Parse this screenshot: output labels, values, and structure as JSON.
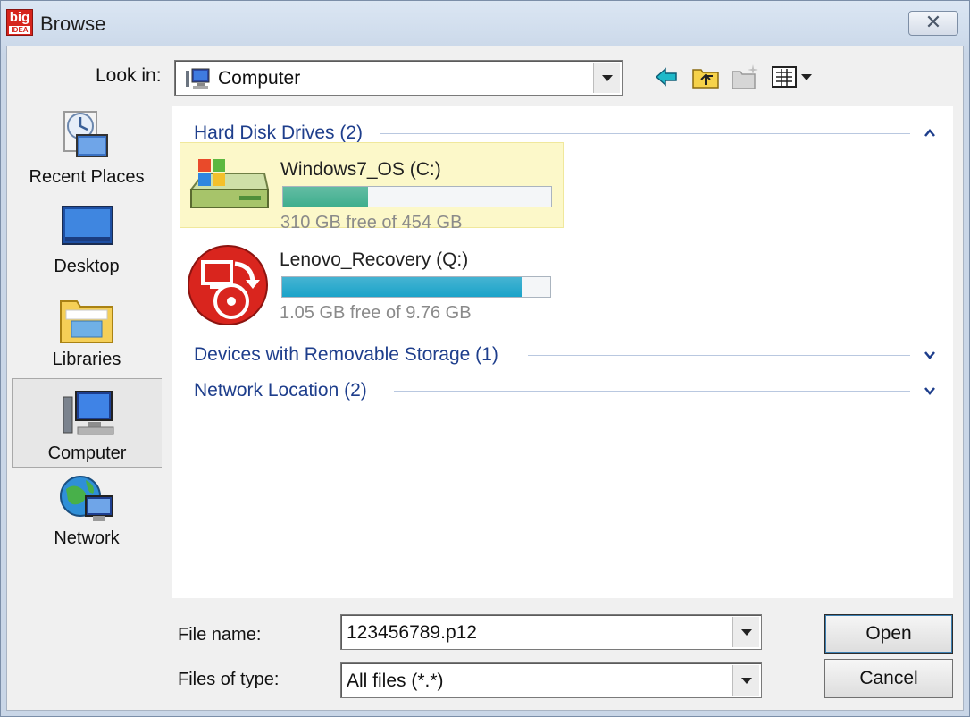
{
  "window": {
    "title": "Browse",
    "app_icon_text": "big",
    "app_icon_subtext": "IDEA",
    "close_glyph": "✕"
  },
  "toolbar": {
    "look_in_label": "Look in:",
    "look_in_value": "Computer",
    "look_in_icon": "computer-icon",
    "tools": [
      "back-arrow-icon",
      "up-folder-icon",
      "new-folder-icon",
      "view-menu-icon"
    ]
  },
  "places": [
    {
      "label": "Recent Places",
      "icon": "recent-places-icon"
    },
    {
      "label": "Desktop",
      "icon": "desktop-icon"
    },
    {
      "label": "Libraries",
      "icon": "libraries-icon"
    },
    {
      "label": "Computer",
      "icon": "computer-icon",
      "selected": true
    },
    {
      "label": "Network",
      "icon": "network-icon"
    }
  ],
  "groups": [
    {
      "header": "Hard Disk Drives (2)",
      "expanded": true
    },
    {
      "header": "Devices with Removable Storage (1)",
      "expanded": false
    },
    {
      "header": "Network Location (2)",
      "expanded": false
    }
  ],
  "drives": [
    {
      "name": "Windows7_OS (C:)",
      "free_text": "310 GB free of 454 GB",
      "used_fraction": 0.317,
      "bar_color": "#3fae8e",
      "icon": "windows-drive-icon",
      "highlighted": true
    },
    {
      "name": "Lenovo_Recovery (Q:)",
      "free_text": "1.05 GB free of 9.76 GB",
      "used_fraction": 0.892,
      "bar_color": "#1aa3c9",
      "icon": "recovery-drive-icon",
      "highlighted": false
    }
  ],
  "footer": {
    "file_name_label": "File name:",
    "file_name_value": "123456789.p12",
    "file_type_label": "Files of type:",
    "file_type_value": "All files (*.*)",
    "open_label": "Open",
    "cancel_label": "Cancel"
  },
  "colors": {
    "group_header": "#1e3e8c",
    "highlight_bg": "#fcf8c9"
  }
}
